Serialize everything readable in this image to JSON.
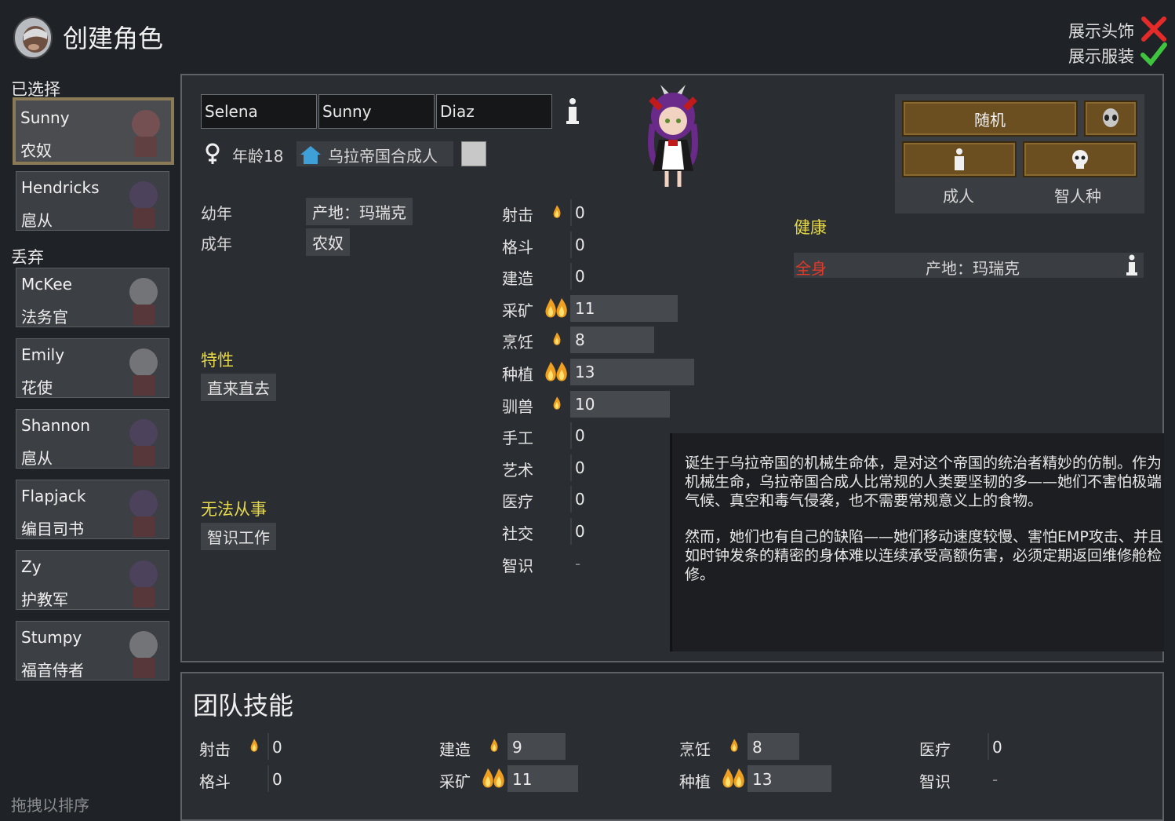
{
  "header": {
    "title": "创建角色",
    "show_headgear_label": "展示头饰",
    "show_clothes_label": "展示服装"
  },
  "left": {
    "selected_label": "已选择",
    "discard_label": "丢弃",
    "drag_hint": "拖拽以排序",
    "selected": [
      {
        "name": "Sunny",
        "title": "农奴"
      },
      {
        "name": "Hendricks",
        "title": "扈从"
      }
    ],
    "discarded": [
      {
        "name": "McKee",
        "title": "法务官"
      },
      {
        "name": "Emily",
        "title": "花使"
      },
      {
        "name": "Shannon",
        "title": "扈从"
      },
      {
        "name": "Flapjack",
        "title": "编目司书"
      },
      {
        "name": "Zy",
        "title": "护教军"
      },
      {
        "name": "Stumpy",
        "title": "福音侍者"
      }
    ]
  },
  "pawn": {
    "first_name": "Selena",
    "nick_name": "Sunny",
    "last_name": "Diaz",
    "age": "年龄18",
    "xenotype": "乌拉帝国合成人",
    "childhood_label": "幼年",
    "childhood": "产地：玛瑞克",
    "adulthood_label": "成年",
    "adulthood": "农奴",
    "traits_label": "特性",
    "traits": [
      "直来直去"
    ],
    "incapable_label": "无法从事",
    "incapable": [
      "智识工作"
    ]
  },
  "skills": [
    {
      "name": "射击",
      "passion": 1,
      "value": "0",
      "level": 0
    },
    {
      "name": "格斗",
      "passion": 0,
      "value": "0",
      "level": 0
    },
    {
      "name": "建造",
      "passion": 0,
      "value": "0",
      "level": 0
    },
    {
      "name": "采矿",
      "passion": 2,
      "value": "11",
      "level": 11
    },
    {
      "name": "烹饪",
      "passion": 1,
      "value": "8",
      "level": 8
    },
    {
      "name": "种植",
      "passion": 2,
      "value": "13",
      "level": 13
    },
    {
      "name": "驯兽",
      "passion": 1,
      "value": "10",
      "level": 10
    },
    {
      "name": "手工",
      "passion": 0,
      "value": "0",
      "level": 0
    },
    {
      "name": "艺术",
      "passion": 0,
      "value": "0",
      "level": 0
    },
    {
      "name": "医疗",
      "passion": 0,
      "value": "0",
      "level": 0
    },
    {
      "name": "社交",
      "passion": 0,
      "value": "0",
      "level": 0
    },
    {
      "name": "智识",
      "passion": 0,
      "value": "-",
      "level": 0
    }
  ],
  "controls": {
    "random_label": "随机",
    "adult_label": "成人",
    "human_label": "智人种"
  },
  "health": {
    "label": "健康",
    "part": "全身",
    "detail": "产地：玛瑞克"
  },
  "description": {
    "p1": "诞生于乌拉帝国的机械生命体，是对这个帝国的统治者精妙的仿制。作为机械生命，乌拉帝国合成人比常规的人类要坚韧的多——她们不害怕极端气候、真空和毒气侵袭，也不需要常规意义上的食物。",
    "p2": "然而，她们也有自己的缺陷——她们移动速度较慢、害怕EMP攻击、并且如时钟发条的精密的身体难以连续承受高额伤害，必须定期返回维修舱检修。"
  },
  "team": {
    "title": "团队技能",
    "skills": [
      {
        "name": "射击",
        "passion": 1,
        "value": "0",
        "level": 0
      },
      {
        "name": "格斗",
        "passion": 0,
        "value": "0",
        "level": 0
      },
      {
        "name": "建造",
        "passion": 1,
        "value": "9",
        "level": 9
      },
      {
        "name": "采矿",
        "passion": 2,
        "value": "11",
        "level": 11
      },
      {
        "name": "烹饪",
        "passion": 1,
        "value": "8",
        "level": 8
      },
      {
        "name": "种植",
        "passion": 2,
        "value": "13",
        "level": 13
      },
      {
        "name": "医疗",
        "passion": 0,
        "value": "0",
        "level": 0
      },
      {
        "name": "智识",
        "passion": 0,
        "value": "-",
        "level": 0
      }
    ]
  },
  "colors": {
    "accent_yellow": "#e5d84a",
    "health_red": "#e03a2a",
    "button_brown": "#6b4f20"
  }
}
